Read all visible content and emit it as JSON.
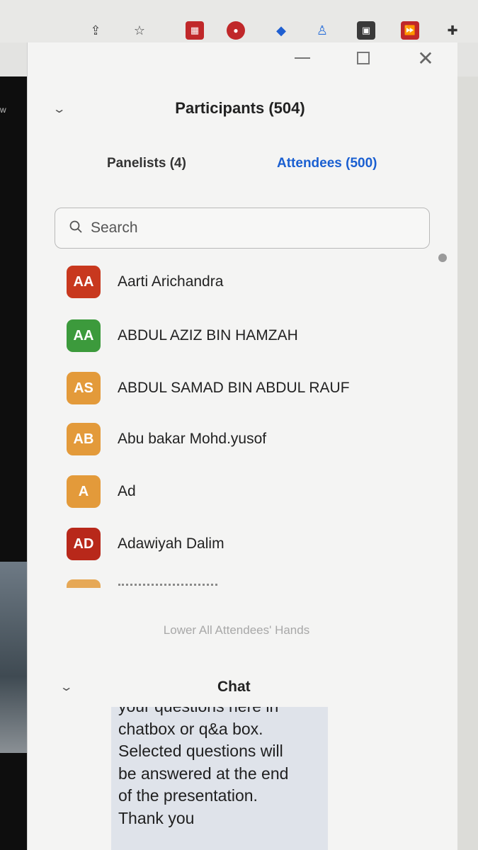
{
  "panel": {
    "title": "Participants (504)",
    "tabs": [
      {
        "label": "Panelists (4)",
        "active": false
      },
      {
        "label": "Attendees (500)",
        "active": true
      }
    ],
    "accent_color": "#1a5fd1"
  },
  "search": {
    "placeholder": "Search"
  },
  "participants": [
    {
      "initials": "AA",
      "name": "Aarti Arichandra",
      "color": "#c8381e"
    },
    {
      "initials": "AA",
      "name": "ABDUL AZIZ BIN HAMZAH",
      "color": "#3c9a3c"
    },
    {
      "initials": "AS",
      "name": "ABDUL SAMAD BIN ABDUL RAUF",
      "color": "#e39a3a"
    },
    {
      "initials": "AB",
      "name": "Abu bakar Mohd.yusof",
      "color": "#e39a3a"
    },
    {
      "initials": "A",
      "name": "Ad",
      "color": "#e39a3a"
    },
    {
      "initials": "AD",
      "name": "Adawiyah Dalim",
      "color": "#b8281a"
    }
  ],
  "lower_hands": {
    "label": "Lower All Attendees' Hands"
  },
  "chat": {
    "title": "Chat",
    "message_lines": [
      "your questions here in",
      "chatbox or q&a box.",
      "Selected questions will",
      "be answered at the end",
      "of the presentation.",
      "Thank you"
    ]
  },
  "video": {
    "label": "w"
  },
  "icons": [
    "share-icon",
    "star-icon",
    "extension-icon",
    "puzzle-icon",
    "minimize-icon",
    "maximize-icon",
    "close-icon",
    "chevron-down-icon",
    "search-icon"
  ]
}
